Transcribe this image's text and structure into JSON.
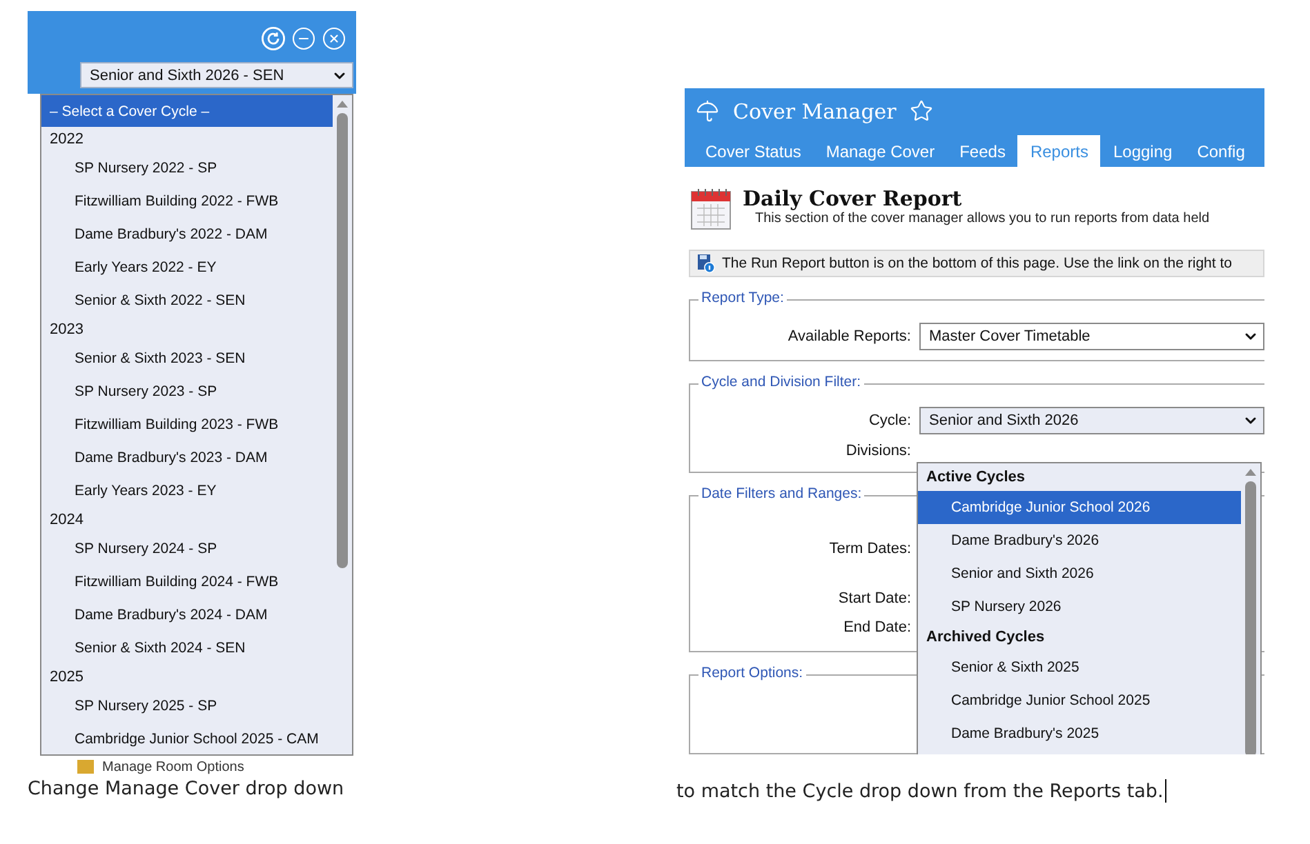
{
  "left_screenshot": {
    "cycle_select": {
      "value": "Senior and Sixth 2026 - SEN"
    },
    "cycle_dropdown": {
      "prompt": {
        "label": "– Select a Cover Cycle –",
        "selected": true
      },
      "groups": [
        {
          "label": "2022",
          "options": [
            {
              "label": "SP Nursery 2022 - SP",
              "selected": false
            },
            {
              "label": "Fitzwilliam Building 2022 - FWB",
              "selected": false
            },
            {
              "label": "Dame Bradbury's 2022 - DAM",
              "selected": false
            },
            {
              "label": "Early Years 2022 - EY",
              "selected": false
            },
            {
              "label": "Senior & Sixth 2022 - SEN",
              "selected": false
            }
          ]
        },
        {
          "label": "2023",
          "options": [
            {
              "label": "Senior & Sixth 2023 - SEN",
              "selected": false
            },
            {
              "label": "SP Nursery 2023 - SP",
              "selected": false
            },
            {
              "label": "Fitzwilliam Building 2023 - FWB",
              "selected": false
            },
            {
              "label": "Dame Bradbury's 2023 - DAM",
              "selected": false
            },
            {
              "label": "Early Years 2023 - EY",
              "selected": false
            }
          ]
        },
        {
          "label": "2024",
          "options": [
            {
              "label": "SP Nursery 2024 - SP",
              "selected": false
            },
            {
              "label": "Fitzwilliam Building 2024 - FWB",
              "selected": false
            },
            {
              "label": "Dame Bradbury's 2024 - DAM",
              "selected": false
            },
            {
              "label": "Senior & Sixth 2024 - SEN",
              "selected": false
            }
          ]
        },
        {
          "label": "2025",
          "options": [
            {
              "label": "SP Nursery 2025 - SP",
              "selected": false
            },
            {
              "label": "Cambridge Junior School 2025 - CAM",
              "selected": false
            }
          ]
        }
      ]
    },
    "menu_item": "Manage Room Options"
  },
  "left_caption": "Change Manage Cover drop down",
  "right_screenshot": {
    "app_title": "Cover Manager",
    "tabs": [
      {
        "label": "Cover Status",
        "selected": false
      },
      {
        "label": "Manage Cover",
        "selected": false
      },
      {
        "label": "Feeds",
        "selected": false
      },
      {
        "label": "Reports",
        "selected": true
      },
      {
        "label": "Logging",
        "selected": false
      },
      {
        "label": "Config",
        "selected": false
      }
    ],
    "page_title": "Daily Cover Report",
    "page_description": "This section of the cover manager allows you to run reports from data held",
    "info_message": "The Run Report button is on the bottom of this page. Use the link on the right to",
    "sections": [
      {
        "legend": "Report Type:",
        "fields": [
          {
            "kind": "select",
            "label": "Available Reports:",
            "value": "Master Cover Timetable"
          }
        ]
      },
      {
        "legend": "Cycle and Division Filter:",
        "fields": [
          {
            "kind": "select",
            "label": "Cycle:",
            "value": "Senior and Sixth 2026"
          },
          {
            "kind": "text",
            "label": "Divisions:"
          }
        ]
      },
      {
        "legend": "Date Filters and Ranges:",
        "fields": [
          {
            "kind": "range",
            "label": "Term Dates:"
          },
          {
            "kind": "text",
            "label": "Start Date:"
          },
          {
            "kind": "text",
            "label": "End Date:"
          }
        ]
      },
      {
        "legend": "Report Options:"
      }
    ],
    "cycle_dropdown": {
      "groups": [
        {
          "label": "Active Cycles",
          "options": [
            {
              "label": "Cambridge Junior School 2026",
              "selected": true
            },
            {
              "label": "Dame Bradbury's 2026",
              "selected": false
            },
            {
              "label": "Senior and Sixth 2026",
              "selected": false
            },
            {
              "label": "SP Nursery 2026",
              "selected": false
            }
          ]
        },
        {
          "label": "Archived Cycles",
          "options": [
            {
              "label": "Senior & Sixth 2025",
              "selected": false
            },
            {
              "label": "Cambridge Junior School 2025",
              "selected": false
            },
            {
              "label": "Dame Bradbury's 2025",
              "selected": false
            }
          ]
        }
      ]
    }
  },
  "right_caption": "to match the Cycle drop down from the Reports tab."
}
